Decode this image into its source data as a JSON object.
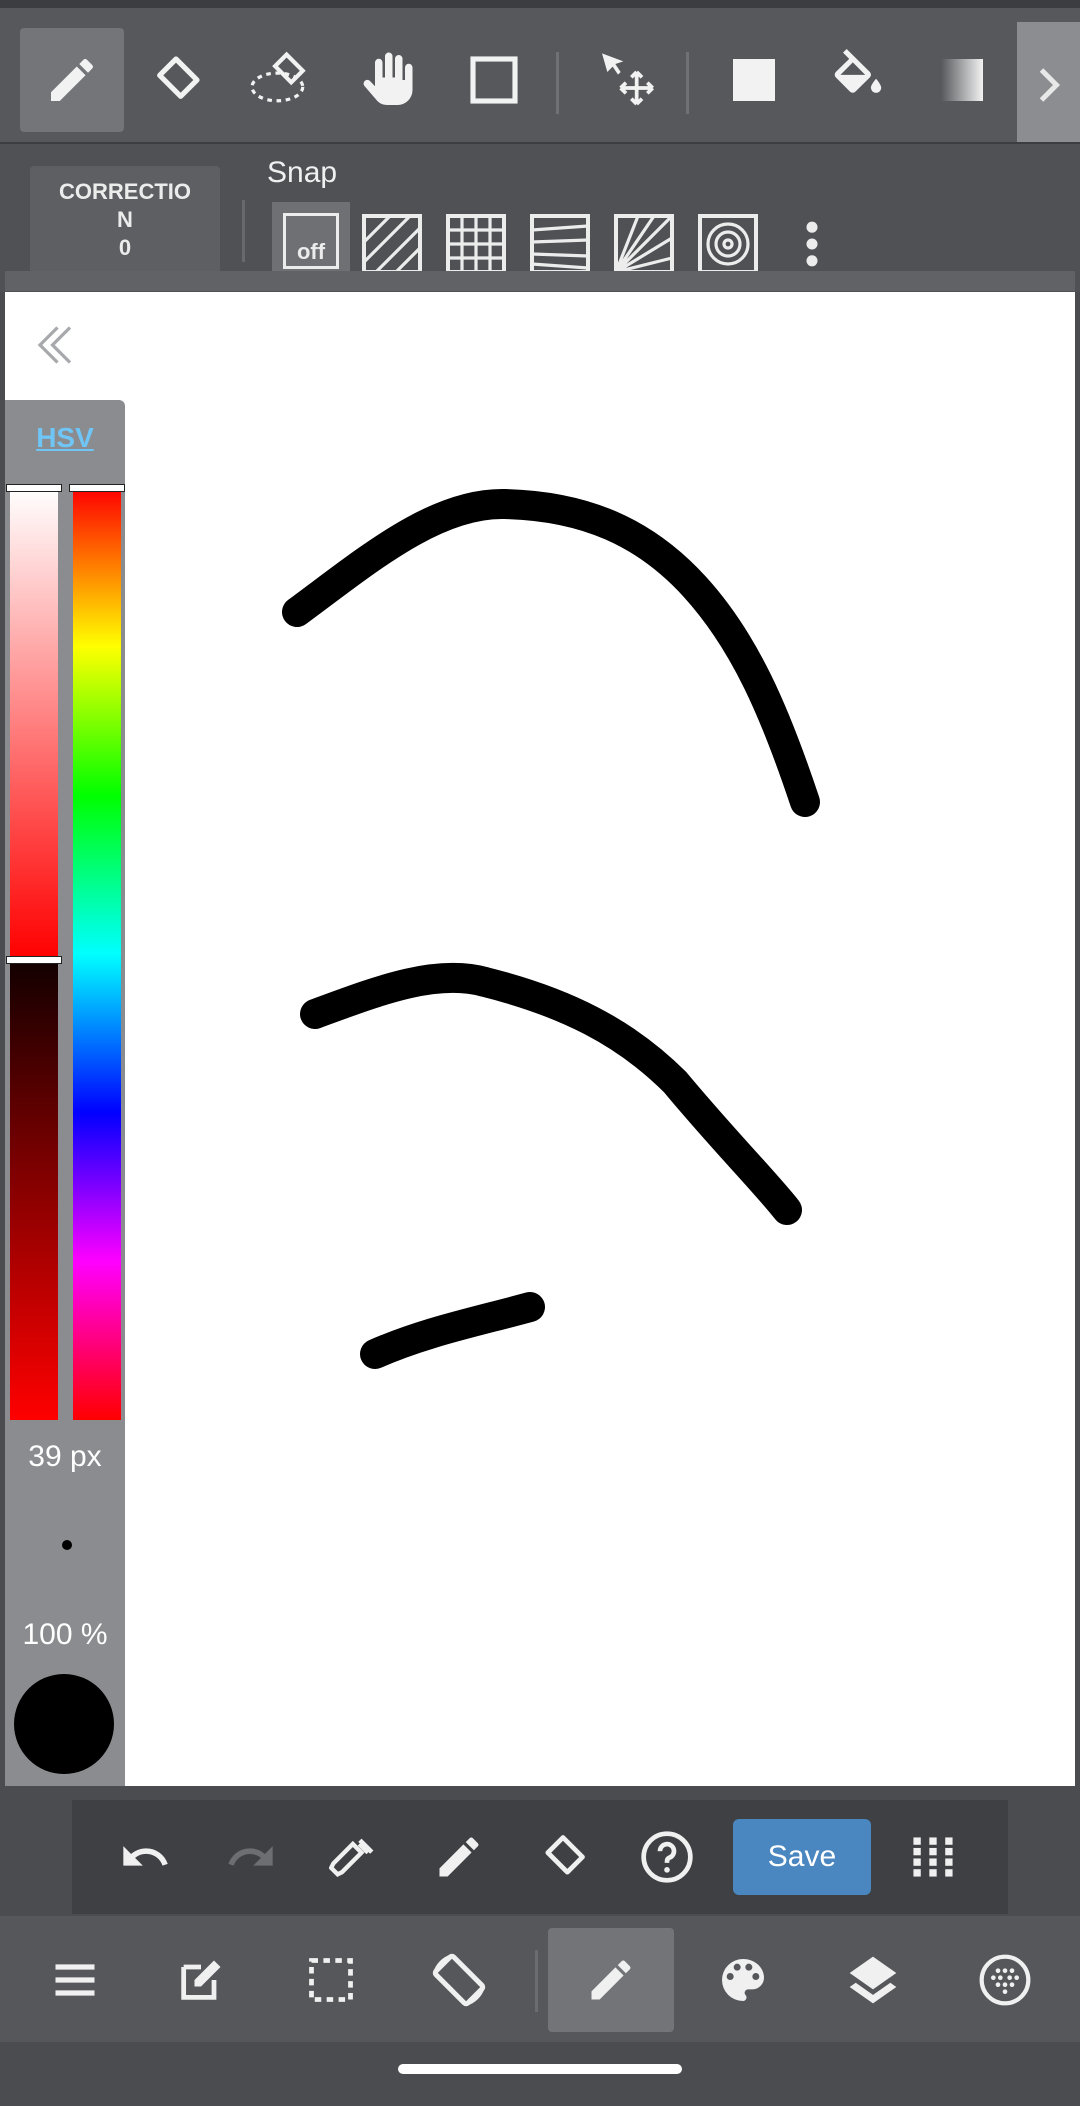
{
  "toolbar": {
    "tools": [
      "brush-icon",
      "eraser-icon",
      "lasso-eraser-icon",
      "hand-icon",
      "square-select-icon",
      "move-icon",
      "fill-rect-icon",
      "bucket-icon",
      "gradient-icon"
    ],
    "active_tool": "brush"
  },
  "subbar": {
    "correction_label": "CORRECTIO\nN",
    "correction_value": "0",
    "snap_label": "Snap",
    "snap_off_label": "off"
  },
  "color_panel": {
    "mode_label": "HSV",
    "brush_size": "39 px",
    "opacity": "100 %",
    "current_color": "#000000"
  },
  "actions": {
    "save_label": "Save"
  },
  "bottom_nav": {
    "items": [
      "menu-icon",
      "edit-icon",
      "selection-icon",
      "rotate-icon",
      "brush-icon",
      "palette-icon",
      "layers-icon",
      "material-icon"
    ],
    "active": "brush"
  },
  "colors": {
    "accent": "#4a86c0",
    "hsv_link": "#6fc5f5"
  }
}
